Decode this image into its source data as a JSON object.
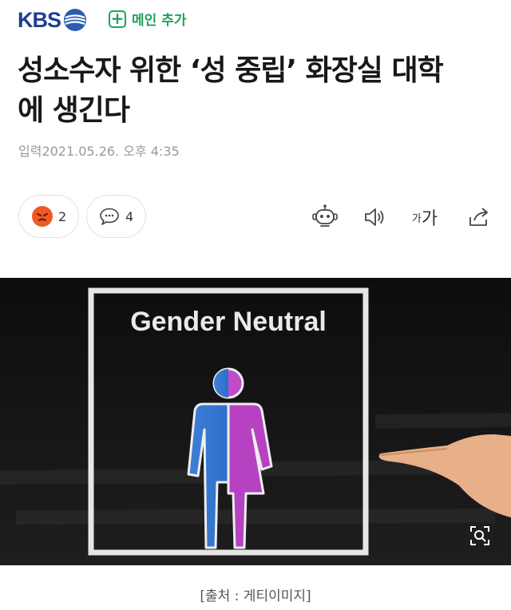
{
  "header": {
    "brand": "KBS",
    "add_main_label": "메인 추가"
  },
  "article": {
    "title_line1": "성소수자 위한 ‘성 중립’ 화장실 대학",
    "title_line2": "에 생긴다",
    "date": "입력2021.05.26. 오후 4:35"
  },
  "reactions": {
    "react_count": "2",
    "comment_count": "4"
  },
  "tools": {
    "font_small": "가",
    "font_large": "가"
  },
  "image": {
    "sign_text": "Gender Neutral"
  },
  "caption": "[출처 : 게티이미지]",
  "colors": {
    "brand_blue": "#1e3f8f",
    "accent_green": "#1fa35b",
    "reaction_orange": "#ef5a24"
  }
}
